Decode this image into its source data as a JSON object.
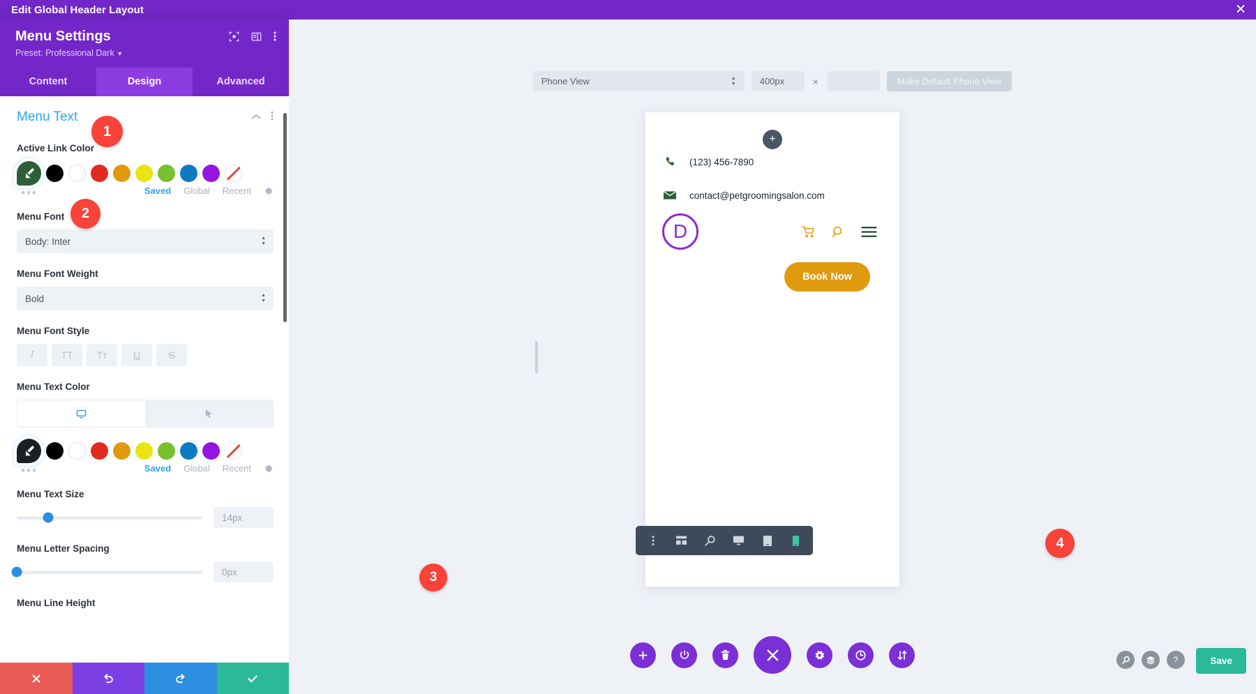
{
  "topbar": {
    "title": "Edit Global Header Layout",
    "close_icon": "close-icon"
  },
  "panel": {
    "title": "Menu Settings",
    "preset_label": "Preset: Professional Dark",
    "head_icons": [
      "focus-target-icon",
      "panel-layout-icon",
      "more-vertical-icon"
    ],
    "tabs": [
      {
        "label": "Content",
        "active": false
      },
      {
        "label": "Design",
        "active": true
      },
      {
        "label": "Advanced",
        "active": false
      }
    ],
    "section": {
      "title": "Menu Text",
      "collapse_icon": "chevron-up-icon",
      "more_icon": "more-vertical-icon"
    },
    "fields": {
      "active_link_color": {
        "label": "Active Link Color",
        "picker_value": "#2c5f35",
        "swatches": [
          "#000000",
          "#ffffff",
          "#e02b20",
          "#e09a10",
          "#e8e312",
          "#79c030",
          "#0c7bc1",
          "#9514e0",
          "none"
        ],
        "more_dots": "•••"
      },
      "color_tabs": {
        "saved": "Saved",
        "global": "Global",
        "recent": "Recent",
        "gear_icon": "gear-icon"
      },
      "menu_font": {
        "label": "Menu Font",
        "value": "Body: Inter"
      },
      "menu_font_weight": {
        "label": "Menu Font Weight",
        "value": "Bold"
      },
      "menu_font_style": {
        "label": "Menu Font Style",
        "buttons": [
          "I",
          "TT",
          "Tт",
          "U",
          "S"
        ]
      },
      "menu_text_color": {
        "label": "Menu Text Color",
        "picker_value": "#1b1f26",
        "tab_desktop_icon": "desktop-icon",
        "tab_hover_icon": "cursor-icon",
        "swatches": [
          "#000000",
          "#ffffff",
          "#e02b20",
          "#e09a10",
          "#e8e312",
          "#79c030",
          "#0c7bc1",
          "#9514e0",
          "none"
        ],
        "more_dots": "•••"
      },
      "menu_text_size": {
        "label": "Menu Text Size",
        "value": "14px",
        "percent": 17
      },
      "menu_letter_spacing": {
        "label": "Menu Letter Spacing",
        "value": "0px",
        "percent": 0
      },
      "menu_line_height": {
        "label": "Menu Line Height"
      }
    },
    "footer": [
      {
        "name": "cancel-button",
        "icon": "x-icon"
      },
      {
        "name": "undo-button",
        "icon": "undo-icon"
      },
      {
        "name": "redo-button",
        "icon": "redo-icon"
      },
      {
        "name": "confirm-button",
        "icon": "check-icon"
      }
    ]
  },
  "canvas": {
    "viewport_bar": {
      "view_select": "Phone View",
      "width_value": "400px",
      "times_symbol": "×",
      "height_value": "",
      "make_default_button": "Make Default Phone View"
    },
    "preview": {
      "add_module_icon": "plus-icon",
      "phone_number": "(123) 456-7890",
      "phone_icon": "phone-icon",
      "email": "contact@petgroomingsalon.com",
      "email_icon": "envelope-icon",
      "logo_letter": "D",
      "nav_icons": [
        "cart-icon",
        "search-icon",
        "hamburger-menu-icon"
      ],
      "cta_label": "Book Now"
    },
    "dark_toolbar": [
      {
        "name": "more-options-icon",
        "active": false
      },
      {
        "name": "wireframe-view-icon",
        "active": false
      },
      {
        "name": "zoom-out-view-icon",
        "active": false
      },
      {
        "name": "desktop-view-icon",
        "active": false
      },
      {
        "name": "tablet-view-icon",
        "active": false
      },
      {
        "name": "phone-view-icon",
        "active": true
      }
    ],
    "circle_actions": [
      {
        "name": "add-section-button",
        "icon": "plus-icon",
        "big": false
      },
      {
        "name": "toggle-builder-button",
        "icon": "power-icon",
        "big": false
      },
      {
        "name": "trash-button",
        "icon": "trash-icon",
        "big": false
      },
      {
        "name": "close-menu-button",
        "icon": "x-icon",
        "big": true
      },
      {
        "name": "settings-button",
        "icon": "gear-icon",
        "big": false
      },
      {
        "name": "history-button",
        "icon": "clock-icon",
        "big": false
      },
      {
        "name": "portability-button",
        "icon": "updown-arrows-icon",
        "big": false
      }
    ],
    "bottom_right_tools": [
      {
        "name": "search-tool-icon",
        "glyph": "search"
      },
      {
        "name": "layers-tool-icon",
        "glyph": "layers"
      },
      {
        "name": "help-tool-icon",
        "glyph": "?"
      }
    ],
    "save_button": "Save"
  },
  "badges": [
    {
      "id": "1",
      "label": "1"
    },
    {
      "id": "2",
      "label": "2"
    },
    {
      "id": "3",
      "label": "3"
    },
    {
      "id": "4",
      "label": "4"
    }
  ],
  "colors": {
    "brand_purple": "#7327c9",
    "accent_blue": "#2ea3f2",
    "save_green": "#2bb99a",
    "badge_red": "#f9423a",
    "cta_orange": "#e09a10",
    "logo_purple": "#9225d8"
  }
}
